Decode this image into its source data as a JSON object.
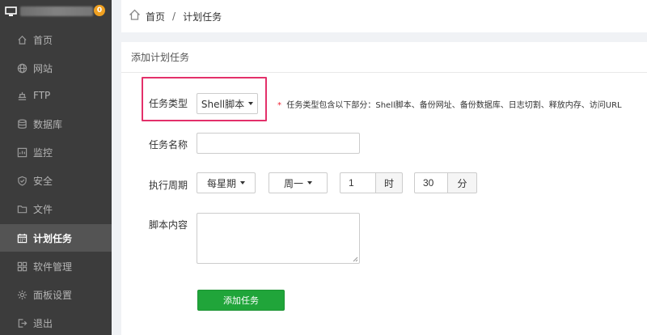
{
  "sidebar": {
    "badge": "0",
    "items": [
      {
        "label": "首页",
        "icon": "home-icon"
      },
      {
        "label": "网站",
        "icon": "globe-icon"
      },
      {
        "label": "FTP",
        "icon": "ftp-icon"
      },
      {
        "label": "数据库",
        "icon": "database-icon"
      },
      {
        "label": "监控",
        "icon": "monitor-icon"
      },
      {
        "label": "安全",
        "icon": "shield-icon"
      },
      {
        "label": "文件",
        "icon": "folder-icon"
      },
      {
        "label": "计划任务",
        "icon": "calendar-icon",
        "active": true
      },
      {
        "label": "软件管理",
        "icon": "apps-icon"
      },
      {
        "label": "面板设置",
        "icon": "gear-icon"
      },
      {
        "label": "退出",
        "icon": "logout-icon"
      }
    ]
  },
  "breadcrumb": {
    "home": "首页",
    "separator": "/",
    "current": "计划任务"
  },
  "panel": {
    "title": "添加计划任务"
  },
  "form": {
    "task_type_label": "任务类型",
    "task_type_value": "Shell脚本",
    "task_type_tip_star": "*",
    "task_type_tip": "任务类型包含以下部分：Shell脚本、备份网址、备份数据库、日志切割、释放内存、访问URL",
    "task_name_label": "任务名称",
    "task_name_value": "",
    "period_label": "执行周期",
    "period_value": "每星期",
    "weekday_value": "周一",
    "hour_value": "1",
    "hour_unit": "时",
    "minute_value": "30",
    "minute_unit": "分",
    "script_label": "脚本内容",
    "script_value": "",
    "submit_label": "添加任务"
  },
  "colors": {
    "accent_green": "#20a53a",
    "highlight_pink": "#e3306a",
    "sidebar_bg": "#3c3c3c",
    "badge": "#f0a020"
  }
}
